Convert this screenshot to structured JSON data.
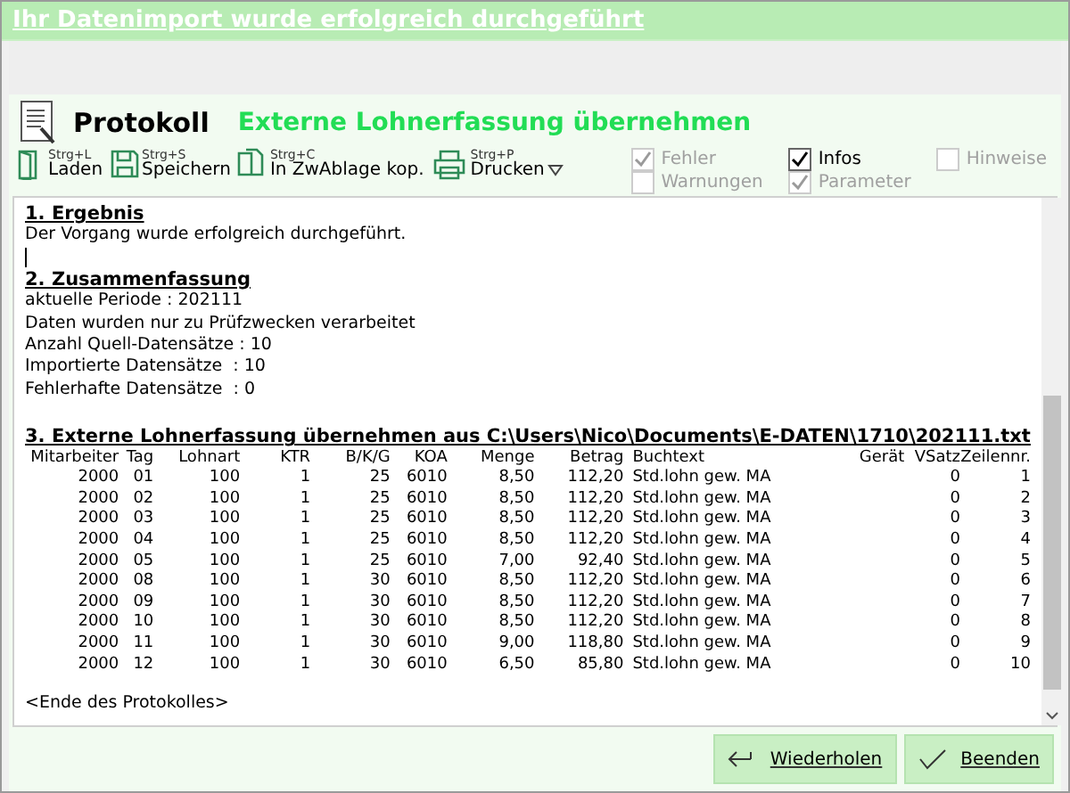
{
  "banner": {
    "title": "Ihr Datenimport wurde erfolgreich durchgeführt"
  },
  "header": {
    "title": "Protokoll",
    "subtitle": "Externe Lohnerfassung übernehmen"
  },
  "toolbar": [
    {
      "kind": "open",
      "shortcut": "Strg+L",
      "label": "Laden",
      "dropdown": false
    },
    {
      "kind": "save",
      "shortcut": "Strg+S",
      "label": "Speichern",
      "dropdown": false
    },
    {
      "kind": "copy",
      "shortcut": "Strg+C",
      "label": "In ZwAblage kop.",
      "dropdown": false
    },
    {
      "kind": "print",
      "shortcut": "Strg+P",
      "label": "Drucken",
      "dropdown": true
    }
  ],
  "filters": [
    {
      "label": "Fehler",
      "checked": true,
      "disabled": true
    },
    {
      "label": "Warnungen",
      "checked": false,
      "disabled": true
    },
    {
      "label": "Infos",
      "checked": true,
      "disabled": false
    },
    {
      "label": "Parameter",
      "checked": true,
      "disabled": true
    },
    {
      "label": "Hinweise",
      "checked": false,
      "disabled": true
    }
  ],
  "report": {
    "result_heading": "1. Ergebnis",
    "result_text": "Der Vorgang wurde erfolgreich durchgeführt.",
    "summary_heading": "2. Zusammenfassung",
    "summary_lines": [
      "aktuelle Periode : 202111",
      "Daten wurden nur zu Prüfzwecken verarbeitet",
      "Anzahl Quell-Datensätze : 10",
      "Importierte Datensätze  : 10",
      "Fehlerhafte Datensätze  : 0"
    ],
    "table_heading": "3. Externe Lohnerfassung übernehmen aus C:\\Users\\Nico\\Documents\\E-DATEN\\1710\\202111.txt",
    "columns": [
      "Mitarbeiter",
      "Tag",
      "Lohnart",
      "KTR",
      "B/K/G",
      "KOA",
      "Menge",
      "Betrag",
      "Buchtext",
      "Gerät",
      "VSatz",
      "Zeilennr."
    ],
    "rows": [
      [
        "2000",
        "01",
        "100",
        "1",
        "25",
        "6010",
        "8,50",
        "112,20",
        "Std.lohn gew. MA",
        "",
        "0",
        "1"
      ],
      [
        "2000",
        "02",
        "100",
        "1",
        "25",
        "6010",
        "8,50",
        "112,20",
        "Std.lohn gew. MA",
        "",
        "0",
        "2"
      ],
      [
        "2000",
        "03",
        "100",
        "1",
        "25",
        "6010",
        "8,50",
        "112,20",
        "Std.lohn gew. MA",
        "",
        "0",
        "3"
      ],
      [
        "2000",
        "04",
        "100",
        "1",
        "25",
        "6010",
        "8,50",
        "112,20",
        "Std.lohn gew. MA",
        "",
        "0",
        "4"
      ],
      [
        "2000",
        "05",
        "100",
        "1",
        "25",
        "6010",
        "7,00",
        "92,40",
        "Std.lohn gew. MA",
        "",
        "0",
        "5"
      ],
      [
        "2000",
        "08",
        "100",
        "1",
        "30",
        "6010",
        "8,50",
        "112,20",
        "Std.lohn gew. MA",
        "",
        "0",
        "6"
      ],
      [
        "2000",
        "09",
        "100",
        "1",
        "30",
        "6010",
        "8,50",
        "112,20",
        "Std.lohn gew. MA",
        "",
        "0",
        "7"
      ],
      [
        "2000",
        "10",
        "100",
        "1",
        "30",
        "6010",
        "8,50",
        "112,20",
        "Std.lohn gew. MA",
        "",
        "0",
        "8"
      ],
      [
        "2000",
        "11",
        "100",
        "1",
        "30",
        "6010",
        "9,00",
        "118,80",
        "Std.lohn gew. MA",
        "",
        "0",
        "9"
      ],
      [
        "2000",
        "12",
        "100",
        "1",
        "30",
        "6010",
        "6,50",
        "85,80",
        "Std.lohn gew. MA",
        "",
        "0",
        "10"
      ]
    ],
    "end_text": "<Ende des Protokolles>"
  },
  "buttons": [
    {
      "kind": "repeat",
      "label": "Wiederholen"
    },
    {
      "kind": "finish",
      "label": "Beenden"
    }
  ]
}
